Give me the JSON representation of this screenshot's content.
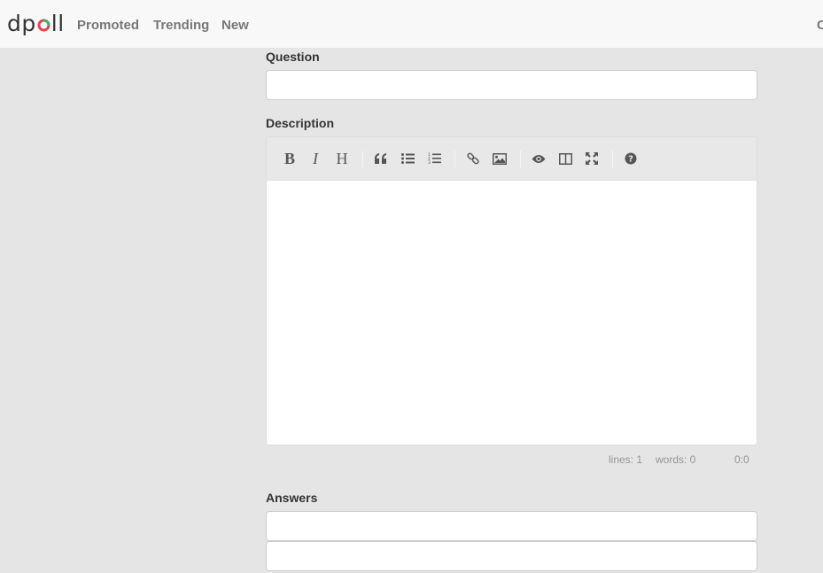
{
  "nav": {
    "logo_text": "dpoll",
    "logo_left": "dp",
    "logo_right": "ll",
    "links": [
      "Promoted",
      "Trending",
      "New"
    ],
    "right_text": "C"
  },
  "form": {
    "question_label": "Question",
    "question_value": "",
    "description_label": "Description",
    "description_value": "",
    "answers_label": "Answers",
    "answers": [
      "",
      ""
    ]
  },
  "editor": {
    "toolbar": [
      "bold",
      "italic",
      "heading",
      "quote",
      "unordered-list",
      "ordered-list",
      "link",
      "image",
      "preview",
      "side-by-side",
      "fullscreen",
      "guide"
    ],
    "status": {
      "lines": "lines: 1",
      "words": "words: 0",
      "cursor": "0:0"
    }
  },
  "colors": {
    "logo_accent_red": "#e8414f",
    "logo_accent_green": "#3cb371",
    "background": "#e5e5e5",
    "navbar": "#f8f8f8"
  }
}
